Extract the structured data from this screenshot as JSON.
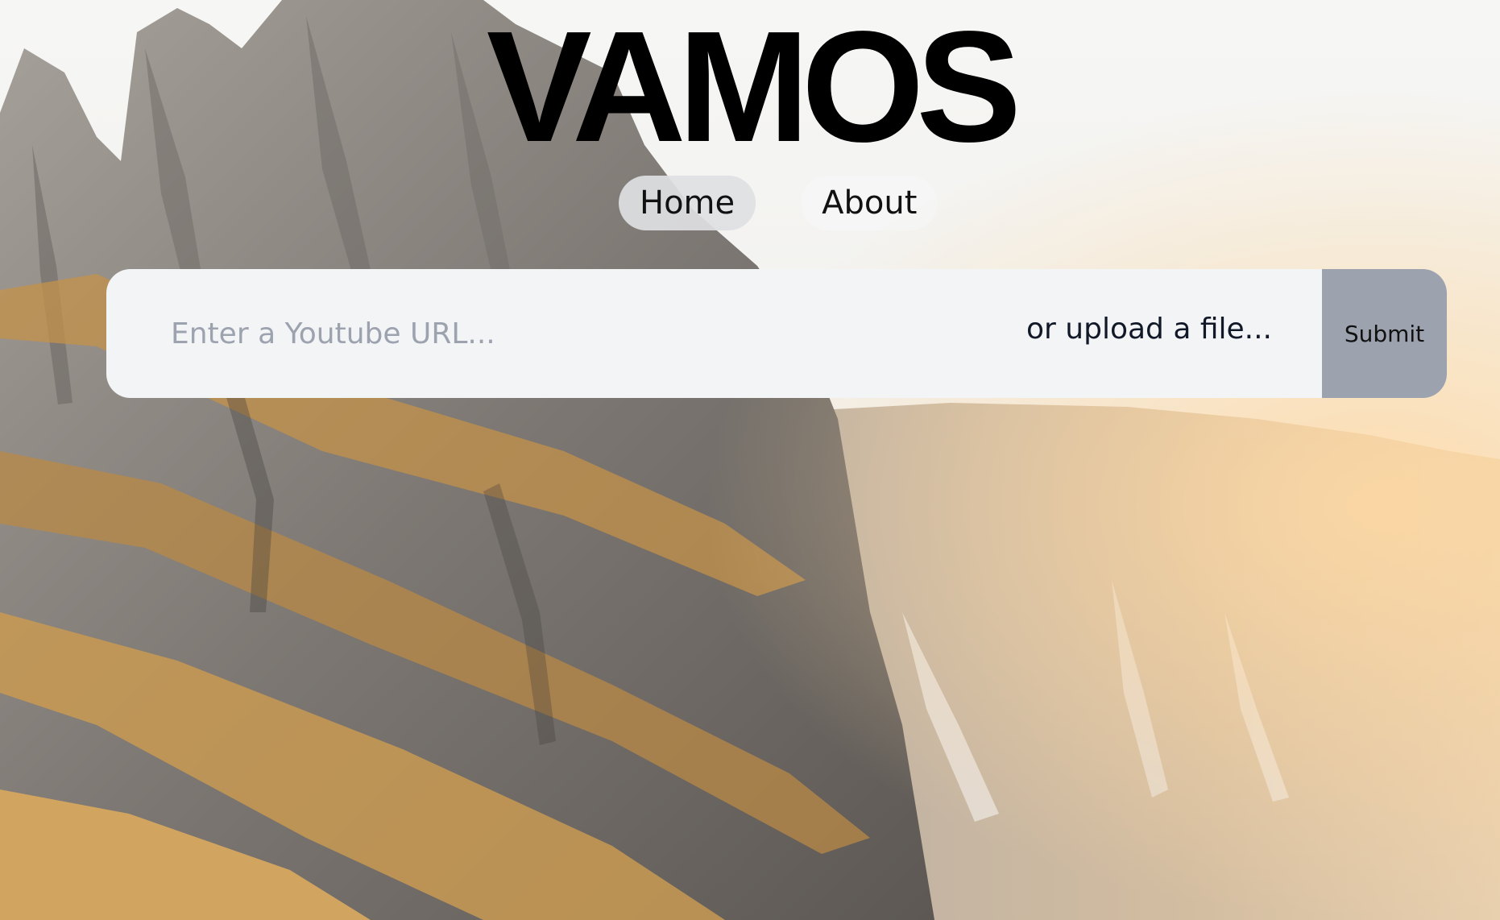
{
  "brand": {
    "title": "VAMOS"
  },
  "nav": {
    "items": [
      {
        "label": "Home",
        "active": true
      },
      {
        "label": "About",
        "active": false
      }
    ]
  },
  "search": {
    "placeholder": "Enter a Youtube URL...",
    "value": "",
    "upload_label": "or upload a file...",
    "submit_label": "Submit"
  },
  "background": {
    "subject": "mountain-landscape",
    "colors": {
      "sky": "#f4f4f2",
      "rock": "#8e8985",
      "grass": "#c4914a",
      "haze": "#e9d2b4"
    }
  },
  "colors": {
    "bar_bg": "#f3f4f6",
    "submit_bg": "#9ca3af",
    "placeholder": "#9ca3af",
    "text": "#111827"
  }
}
